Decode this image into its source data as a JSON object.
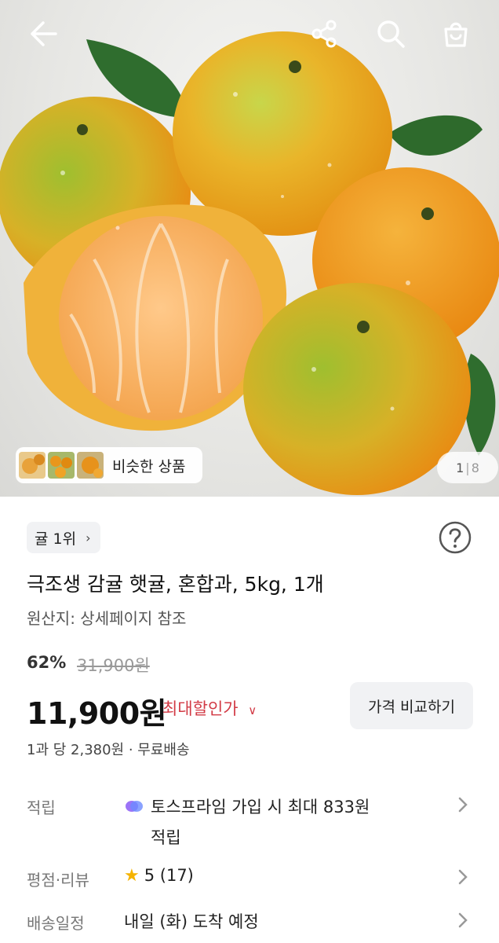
{
  "hero": {
    "similar_label": "비슷한 상품",
    "counter_current": "1",
    "counter_total": "8"
  },
  "topbar": {
    "icons": [
      "back-arrow-icon",
      "share-icon",
      "search-icon",
      "cart-icon"
    ]
  },
  "product": {
    "rank_label": "귤 1위",
    "title": "극조생 감귤 햇귤, 혼합과, 5kg, 1개",
    "origin": "원산지: 상세페이지 참조",
    "discount": "62%",
    "original_price": "31,900원",
    "price": "11,900원",
    "best_price_label": "최대할인가",
    "compare_label": "가격 비교하기",
    "unit_info": "1과 당 2,380원 · 무료배송"
  },
  "details": {
    "points_label": "적립",
    "points_value_line1": "토스프라임 가입 시 최대 833원",
    "points_value_line2": "적립",
    "rating_label": "평점·리뷰",
    "rating_value": "5 (17)",
    "delivery_label": "배송일정",
    "delivery_value": "내일 (화) 도착 예정"
  },
  "colors": {
    "accent_red": "#d23a45",
    "chip_bg": "#f1f2f4",
    "star": "#f5b300"
  }
}
